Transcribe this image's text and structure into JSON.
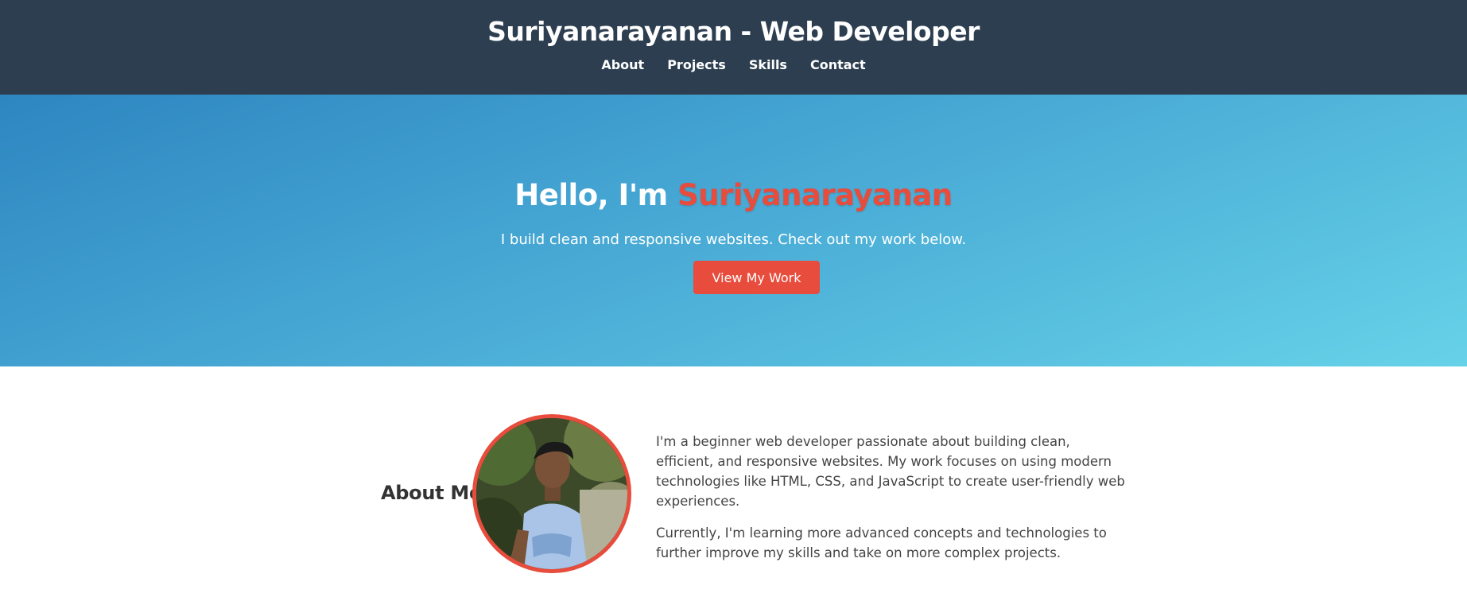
{
  "header": {
    "title": "Suriyanarayanan - Web Developer",
    "nav": [
      "About",
      "Projects",
      "Skills",
      "Contact"
    ]
  },
  "hero": {
    "greeting": "Hello, I'm",
    "name": "Suriyanarayanan",
    "tagline": "I build clean and responsive websites. Check out my work below.",
    "cta_label": "View My Work"
  },
  "about": {
    "title": "About Me",
    "paragraphs": [
      "I'm a beginner web developer passionate about building clean, efficient, and responsive websites. My work focuses on using modern technologies like HTML, CSS, and JavaScript to create user-friendly web experiences.",
      "Currently, I'm learning more advanced concepts and technologies to further improve my skills and take on more complex projects."
    ]
  },
  "colors": {
    "header_bg": "#2c3e50",
    "accent": "#e74c3c",
    "hero_gradient_start": "#2e86c1",
    "hero_gradient_end": "#66d2e8"
  }
}
